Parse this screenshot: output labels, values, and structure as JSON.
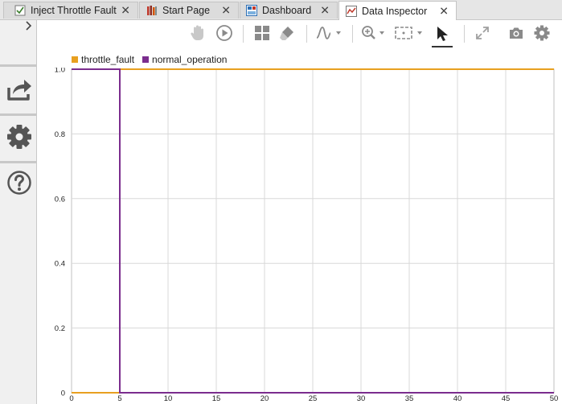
{
  "tabs": [
    {
      "label": "Inject Throttle Fault",
      "icon": "model-icon",
      "active": false
    },
    {
      "label": "Start Page",
      "icon": "library-icon",
      "active": false
    },
    {
      "label": "Dashboard",
      "icon": "dashboard-icon",
      "active": false
    },
    {
      "label": "Data Inspector",
      "icon": "data-inspector-icon",
      "active": true
    }
  ],
  "sidebar": {
    "collapse_icon": "chevron-right-icon",
    "buttons": [
      "share-icon",
      "gear-icon",
      "help-icon"
    ]
  },
  "toolbar": {
    "icons": [
      "pan-hand-icon",
      "play-icon",
      "layout-grid-icon",
      "eraser-icon",
      "signal-style-icon",
      "zoom-in-icon",
      "fit-to-view-icon",
      "cursor-icon",
      "expand-icon",
      "snapshot-icon",
      "settings-icon"
    ]
  },
  "legend": [
    {
      "name": "throttle_fault",
      "color": "#e8a020"
    },
    {
      "name": "normal_operation",
      "color": "#7b2d8e"
    }
  ],
  "chart_data": {
    "type": "line",
    "xlim": [
      0,
      50
    ],
    "ylim": [
      0,
      1.0
    ],
    "x_ticks": [
      0,
      5,
      10,
      15,
      20,
      25,
      30,
      35,
      40,
      45,
      50
    ],
    "y_ticks": [
      0,
      0.2,
      0.4,
      0.6,
      0.8,
      1.0
    ],
    "x_tick_labels": [
      "0",
      "5",
      "10",
      "15",
      "20",
      "25",
      "30",
      "35",
      "40",
      "45",
      "50"
    ],
    "y_tick_labels": [
      "0",
      "0.2",
      "0.4",
      "0.6",
      "0.8",
      "1.0"
    ],
    "grid": true,
    "series": [
      {
        "name": "throttle_fault",
        "color": "#e8a020",
        "x": [
          0,
          5,
          5,
          50
        ],
        "y": [
          0,
          0,
          1,
          1
        ]
      },
      {
        "name": "normal_operation",
        "color": "#7b2d8e",
        "x": [
          0,
          5,
          5,
          50
        ],
        "y": [
          1,
          1,
          0,
          0
        ]
      }
    ]
  }
}
